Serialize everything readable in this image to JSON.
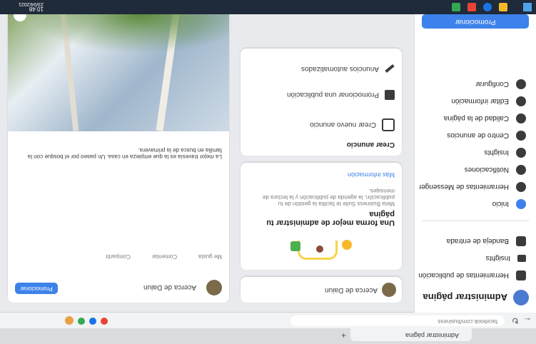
{
  "browser": {
    "tabs_left": "Administrar página",
    "url_text": "facebook.com/business",
    "bookmark_label": "Apps"
  },
  "sidebar": {
    "title": "Administrar página",
    "tools_label": "Herramientas de publicación",
    "items": [
      {
        "icon": "store-icon",
        "label": "Herramientas de publicación"
      },
      {
        "icon": "insights-icon",
        "label": "Insights"
      },
      {
        "icon": "page-icon",
        "label": "Bandeja de entrada"
      }
    ],
    "nav": [
      {
        "icon": "home-icon",
        "label": "Inicio"
      },
      {
        "icon": "messenger-icon",
        "label": "Herramientas de Messenger"
      },
      {
        "icon": "bell-icon",
        "label": "Notificaciones"
      },
      {
        "icon": "insights-icon",
        "label": "Insights"
      },
      {
        "icon": "ads-icon",
        "label": "Centro de anuncios"
      },
      {
        "icon": "quality-icon",
        "label": "Calidad de la página"
      },
      {
        "icon": "edit-icon",
        "label": "Editar información"
      },
      {
        "icon": "gear-icon",
        "label": "Configurar"
      }
    ],
    "promote_button": "Promocionar"
  },
  "main": {
    "composer_label": "Acerca de Daiun",
    "card_title": "Una forma mejor de administrar tu página",
    "card_text": "Meta Business Suite te facilita la gestión de tu publicación, la agenda de publicación y la lectura de mensajes.",
    "card_link": "Más información",
    "ad_title": "Crear anuncio",
    "ad_item1": "Crear nuevo anuncio",
    "ad_item2": "Promocionar una publicación",
    "ad_item3": "Anuncios automatizados",
    "post_author": "Acerca de Daiun",
    "post_text": "La mejor travesía es la que empieza en casa. Un paseo por el bosque con la familia en busca de la primavera.",
    "like_label": "Me gusta",
    "comment_label": "Comentar",
    "share_label": "Compartir"
  },
  "status": {
    "time": "10:48",
    "date": "23/04/2021"
  }
}
